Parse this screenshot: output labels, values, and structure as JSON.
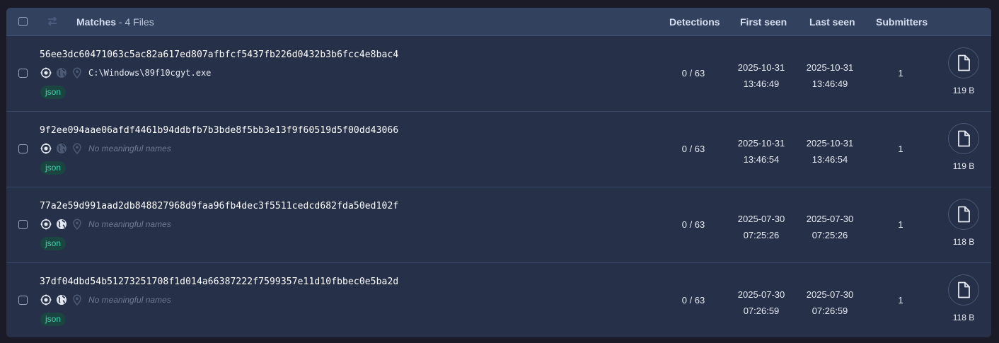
{
  "header": {
    "matches_label": "Matches",
    "files_label": " - 4 Files",
    "col_detections": "Detections",
    "col_first_seen": "First seen",
    "col_last_seen": "Last seen",
    "col_submitters": "Submitters"
  },
  "icons": {
    "swap": "swap-arrows-icon",
    "detection": "target-icon",
    "network": "globe-icon",
    "location": "location-pin-icon",
    "file": "file-icon"
  },
  "colors": {
    "panel": "#263048",
    "header": "#31415e",
    "tag_bg": "#1a4541",
    "tag_text": "#3fd4ad"
  },
  "rows": [
    {
      "hash": "56ee3dc60471063c5ac82a617ed807afbfcf5437fb226d0432b3b6fcc4e8bac4",
      "name": "C:\\Windows\\89f10cgyt.exe",
      "has_name": true,
      "globe_active": false,
      "tag": "json",
      "detections": "0 / 63",
      "first_seen_date": "2025-10-31",
      "first_seen_time": "13:46:49",
      "last_seen_date": "2025-10-31",
      "last_seen_time": "13:46:49",
      "submitters": "1",
      "size": "119 B"
    },
    {
      "hash": "9f2ee094aae06afdf4461b94ddbfb7b3bde8f5bb3e13f9f60519d5f00dd43066",
      "name": "No meaningful names",
      "has_name": false,
      "globe_active": false,
      "tag": "json",
      "detections": "0 / 63",
      "first_seen_date": "2025-10-31",
      "first_seen_time": "13:46:54",
      "last_seen_date": "2025-10-31",
      "last_seen_time": "13:46:54",
      "submitters": "1",
      "size": "119 B"
    },
    {
      "hash": "77a2e59d991aad2db848827968d9faa96fb4dec3f5511cedcd682fda50ed102f",
      "name": "No meaningful names",
      "has_name": false,
      "globe_active": true,
      "tag": "json",
      "detections": "0 / 63",
      "first_seen_date": "2025-07-30",
      "first_seen_time": "07:25:26",
      "last_seen_date": "2025-07-30",
      "last_seen_time": "07:25:26",
      "submitters": "1",
      "size": "118 B"
    },
    {
      "hash": "37df04dbd54b51273251708f1d014a66387222f7599357e11d10fbbec0e5ba2d",
      "name": "No meaningful names",
      "has_name": false,
      "globe_active": true,
      "tag": "json",
      "detections": "0 / 63",
      "first_seen_date": "2025-07-30",
      "first_seen_time": "07:26:59",
      "last_seen_date": "2025-07-30",
      "last_seen_time": "07:26:59",
      "submitters": "1",
      "size": "118 B"
    }
  ]
}
